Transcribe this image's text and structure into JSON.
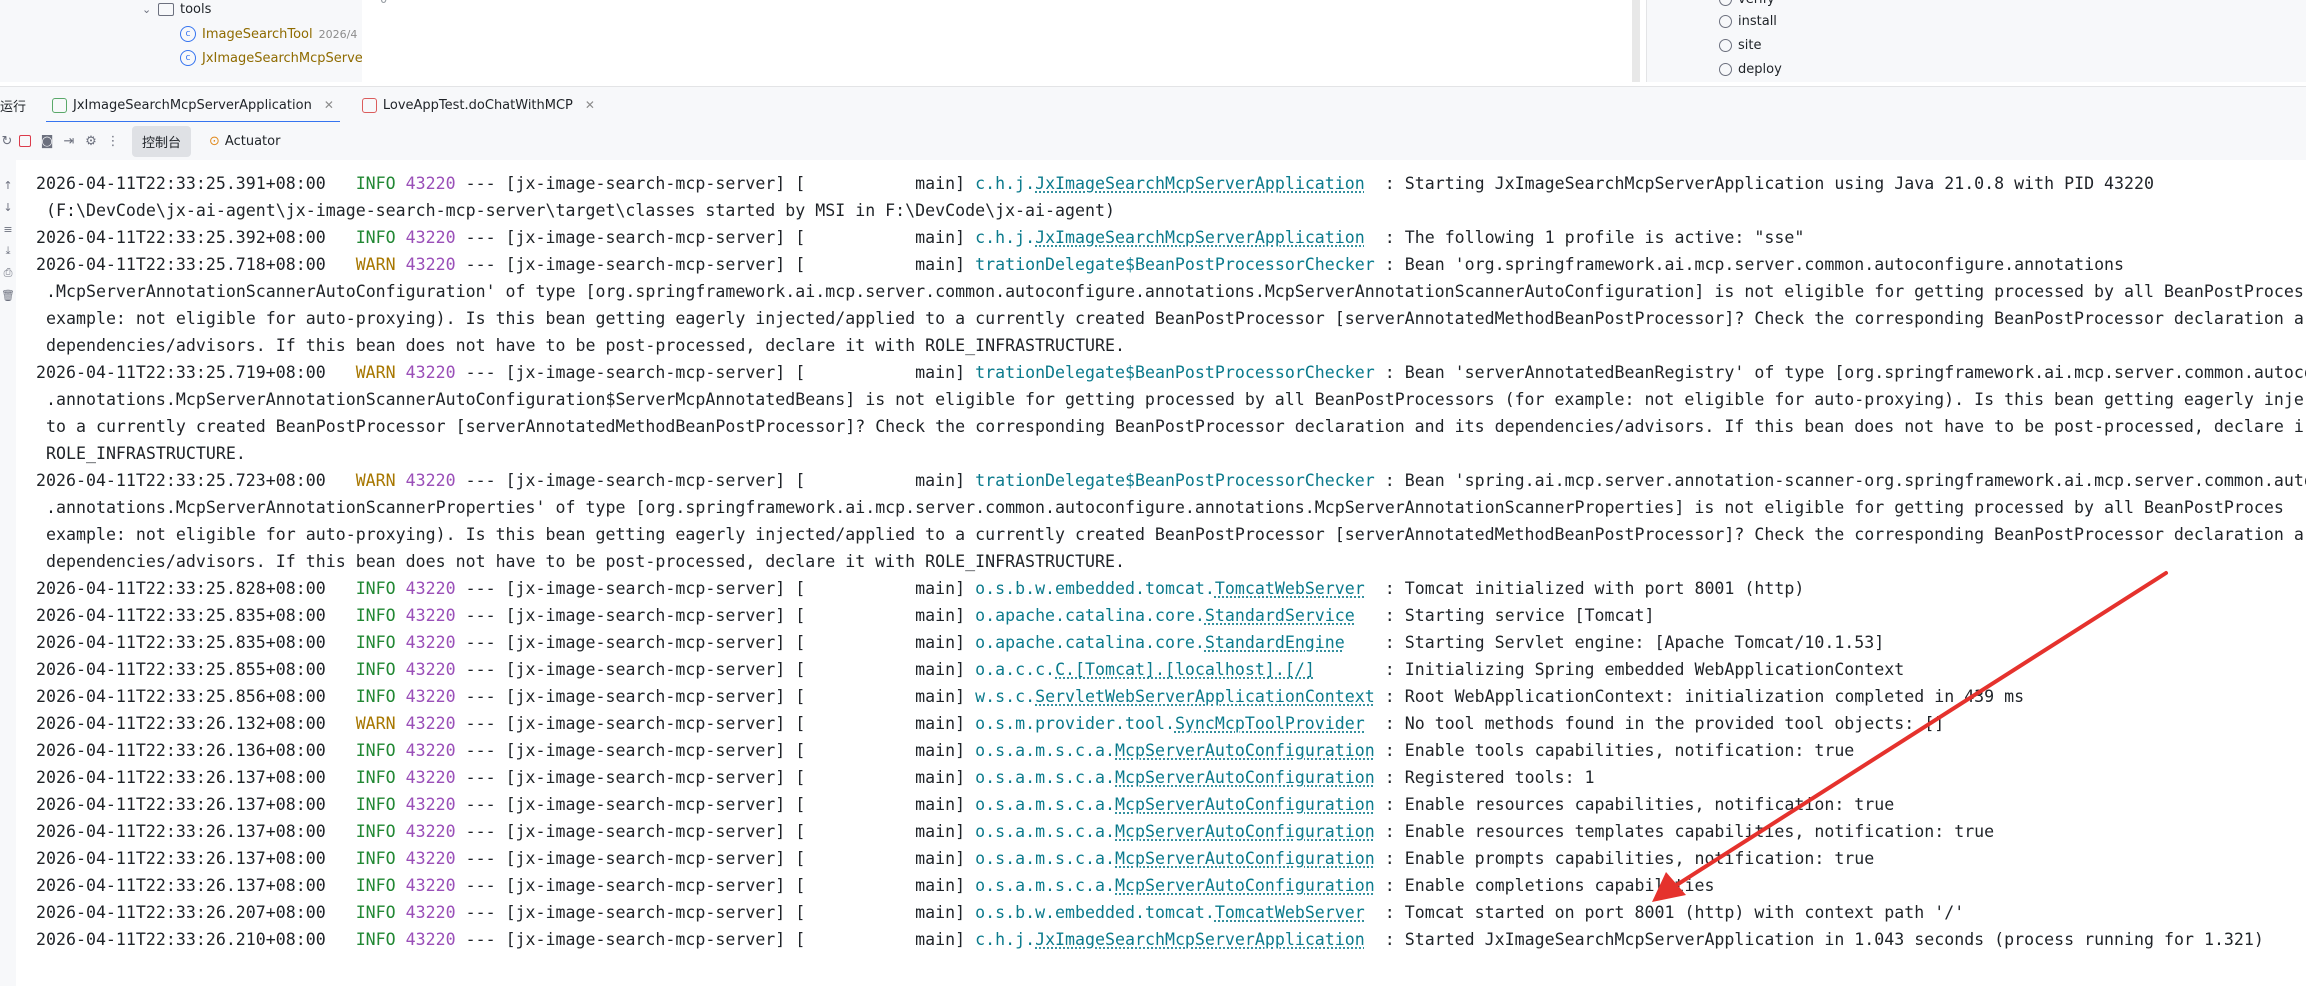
{
  "project_tree": {
    "folder": "tools",
    "items": [
      {
        "name": "ImageSearchTool",
        "date": "2026/4"
      },
      {
        "name": "JxImageSearchMcpServerAp",
        "date": ""
      }
    ],
    "gutter_number": "0"
  },
  "maven_panel": {
    "items": [
      "verify",
      "install",
      "site",
      "deploy"
    ]
  },
  "run_panel": {
    "label": "运行",
    "tabs": [
      {
        "label": "JxImageSearchMcpServerApplication",
        "active": true
      },
      {
        "label": "LoveAppTest.doChatWithMCP",
        "active": false
      }
    ],
    "subtabs": [
      {
        "label": "控制台",
        "active": true
      },
      {
        "label": "Actuator",
        "active": false
      }
    ]
  },
  "colors": {
    "info": "#218733",
    "warn": "#a77700",
    "pid": "#9a4fb8",
    "logger": "#0b7a8c",
    "arrow": "#e5322d",
    "accent": "#3574f0"
  },
  "console": {
    "lines": [
      {
        "ts": "2026-04-11T22:33:25.391+08:00",
        "level": "INFO",
        "pid": "43220",
        "app": "[jx-image-search-mcp-server]",
        "thread": "main",
        "logger_prefix": "c.h.j.",
        "logger_link": "JxImageSearchMcpServerApplication",
        "msg": "Starting JxImageSearchMcpServerApplication using Java 21.0.8 with PID 43220"
      },
      {
        "cont": "(F:\\DevCode\\jx-ai-agent\\jx-image-search-mcp-server\\target\\classes started by MSI in F:\\DevCode\\jx-ai-agent)"
      },
      {
        "ts": "2026-04-11T22:33:25.392+08:00",
        "level": "INFO",
        "pid": "43220",
        "app": "[jx-image-search-mcp-server]",
        "thread": "main",
        "logger_prefix": "c.h.j.",
        "logger_link": "JxImageSearchMcpServerApplication",
        "msg": "The following 1 profile is active: \"sse\""
      },
      {
        "ts": "2026-04-11T22:33:25.718+08:00",
        "level": "WARN",
        "pid": "43220",
        "app": "[jx-image-search-mcp-server]",
        "thread": "main",
        "logger_prefix": "trationDelegate$BeanPostProcessorChecker",
        "logger_link": "",
        "msg": "Bean 'org.springframework.ai.mcp.server.common.autoconfigure.annotations"
      },
      {
        "cont": ".McpServerAnnotationScannerAutoConfiguration' of type [org.springframework.ai.mcp.server.common.autoconfigure.annotations.McpServerAnnotationScannerAutoConfiguration] is not eligible for getting processed by all BeanPostProces"
      },
      {
        "cont": "example: not eligible for auto-proxying). Is this bean getting eagerly injected/applied to a currently created BeanPostProcessor [serverAnnotatedMethodBeanPostProcessor]? Check the corresponding BeanPostProcessor declaration a"
      },
      {
        "cont": "dependencies/advisors. If this bean does not have to be post-processed, declare it with ROLE_INFRASTRUCTURE."
      },
      {
        "ts": "2026-04-11T22:33:25.719+08:00",
        "level": "WARN",
        "pid": "43220",
        "app": "[jx-image-search-mcp-server]",
        "thread": "main",
        "logger_prefix": "trationDelegate$BeanPostProcessorChecker",
        "logger_link": "",
        "msg": "Bean 'serverAnnotatedBeanRegistry' of type [org.springframework.ai.mcp.server.common.autoco"
      },
      {
        "cont": ".annotations.McpServerAnnotationScannerAutoConfiguration$ServerMcpAnnotatedBeans] is not eligible for getting processed by all BeanPostProcessors (for example: not eligible for auto-proxying). Is this bean getting eagerly inje"
      },
      {
        "cont": "to a currently created BeanPostProcessor [serverAnnotatedMethodBeanPostProcessor]? Check the corresponding BeanPostProcessor declaration and its dependencies/advisors. If this bean does not have to be post-processed, declare i"
      },
      {
        "cont": "ROLE_INFRASTRUCTURE."
      },
      {
        "ts": "2026-04-11T22:33:25.723+08:00",
        "level": "WARN",
        "pid": "43220",
        "app": "[jx-image-search-mcp-server]",
        "thread": "main",
        "logger_prefix": "trationDelegate$BeanPostProcessorChecker",
        "logger_link": "",
        "msg": "Bean 'spring.ai.mcp.server.annotation-scanner-org.springframework.ai.mcp.server.common.auto"
      },
      {
        "cont": ".annotations.McpServerAnnotationScannerProperties' of type [org.springframework.ai.mcp.server.common.autoconfigure.annotations.McpServerAnnotationScannerProperties] is not eligible for getting processed by all BeanPostProces"
      },
      {
        "cont": "example: not eligible for auto-proxying). Is this bean getting eagerly injected/applied to a currently created BeanPostProcessor [serverAnnotatedMethodBeanPostProcessor]? Check the corresponding BeanPostProcessor declaration a"
      },
      {
        "cont": "dependencies/advisors. If this bean does not have to be post-processed, declare it with ROLE_INFRASTRUCTURE."
      },
      {
        "ts": "2026-04-11T22:33:25.828+08:00",
        "level": "INFO",
        "pid": "43220",
        "app": "[jx-image-search-mcp-server]",
        "thread": "main",
        "logger_prefix": "o.s.b.w.embedded.tomcat.",
        "logger_link": "TomcatWebServer",
        "msg": "Tomcat initialized with port 8001 (http)"
      },
      {
        "ts": "2026-04-11T22:33:25.835+08:00",
        "level": "INFO",
        "pid": "43220",
        "app": "[jx-image-search-mcp-server]",
        "thread": "main",
        "logger_prefix": "o.apache.catalina.core.",
        "logger_link": "StandardService",
        "msg": "Starting service [Tomcat]"
      },
      {
        "ts": "2026-04-11T22:33:25.835+08:00",
        "level": "INFO",
        "pid": "43220",
        "app": "[jx-image-search-mcp-server]",
        "thread": "main",
        "logger_prefix": "o.apache.catalina.core.",
        "logger_link": "StandardEngine",
        "msg": "Starting Servlet engine: [Apache Tomcat/10.1.53]"
      },
      {
        "ts": "2026-04-11T22:33:25.855+08:00",
        "level": "INFO",
        "pid": "43220",
        "app": "[jx-image-search-mcp-server]",
        "thread": "main",
        "logger_prefix": "o.a.c.c.",
        "logger_link": "C.[Tomcat].[localhost].[/]",
        "msg": "Initializing Spring embedded WebApplicationContext"
      },
      {
        "ts": "2026-04-11T22:33:25.856+08:00",
        "level": "INFO",
        "pid": "43220",
        "app": "[jx-image-search-mcp-server]",
        "thread": "main",
        "logger_prefix": "w.s.c.",
        "logger_link": "ServletWebServerApplicationContext",
        "msg": "Root WebApplicationContext: initialization completed in 439 ms"
      },
      {
        "ts": "2026-04-11T22:33:26.132+08:00",
        "level": "WARN",
        "pid": "43220",
        "app": "[jx-image-search-mcp-server]",
        "thread": "main",
        "logger_prefix": "o.s.m.provider.tool.",
        "logger_link": "SyncMcpToolProvider",
        "msg": "No tool methods found in the provided tool objects: []"
      },
      {
        "ts": "2026-04-11T22:33:26.136+08:00",
        "level": "INFO",
        "pid": "43220",
        "app": "[jx-image-search-mcp-server]",
        "thread": "main",
        "logger_prefix": "o.s.a.m.s.c.a.",
        "logger_link": "McpServerAutoConfiguration",
        "msg": "Enable tools capabilities, notification: true"
      },
      {
        "ts": "2026-04-11T22:33:26.137+08:00",
        "level": "INFO",
        "pid": "43220",
        "app": "[jx-image-search-mcp-server]",
        "thread": "main",
        "logger_prefix": "o.s.a.m.s.c.a.",
        "logger_link": "McpServerAutoConfiguration",
        "msg": "Registered tools: 1"
      },
      {
        "ts": "2026-04-11T22:33:26.137+08:00",
        "level": "INFO",
        "pid": "43220",
        "app": "[jx-image-search-mcp-server]",
        "thread": "main",
        "logger_prefix": "o.s.a.m.s.c.a.",
        "logger_link": "McpServerAutoConfiguration",
        "msg": "Enable resources capabilities, notification: true"
      },
      {
        "ts": "2026-04-11T22:33:26.137+08:00",
        "level": "INFO",
        "pid": "43220",
        "app": "[jx-image-search-mcp-server]",
        "thread": "main",
        "logger_prefix": "o.s.a.m.s.c.a.",
        "logger_link": "McpServerAutoConfiguration",
        "msg": "Enable resources templates capabilities, notification: true"
      },
      {
        "ts": "2026-04-11T22:33:26.137+08:00",
        "level": "INFO",
        "pid": "43220",
        "app": "[jx-image-search-mcp-server]",
        "thread": "main",
        "logger_prefix": "o.s.a.m.s.c.a.",
        "logger_link": "McpServerAutoConfiguration",
        "msg": "Enable prompts capabilities, notification: true"
      },
      {
        "ts": "2026-04-11T22:33:26.137+08:00",
        "level": "INFO",
        "pid": "43220",
        "app": "[jx-image-search-mcp-server]",
        "thread": "main",
        "logger_prefix": "o.s.a.m.s.c.a.",
        "logger_link": "McpServerAutoConfiguration",
        "msg": "Enable completions capabilities"
      },
      {
        "ts": "2026-04-11T22:33:26.207+08:00",
        "level": "INFO",
        "pid": "43220",
        "app": "[jx-image-search-mcp-server]",
        "thread": "main",
        "logger_prefix": "o.s.b.w.embedded.tomcat.",
        "logger_link": "TomcatWebServer",
        "msg": "Tomcat started on port 8001 (http) with context path '/'"
      },
      {
        "ts": "2026-04-11T22:33:26.210+08:00",
        "level": "INFO",
        "pid": "43220",
        "app": "[jx-image-search-mcp-server]",
        "thread": "main",
        "logger_prefix": "c.h.j.",
        "logger_link": "JxImageSearchMcpServerApplication",
        "msg": "Started JxImageSearchMcpServerApplication in 1.043 seconds (process running for 1.321)"
      }
    ]
  }
}
